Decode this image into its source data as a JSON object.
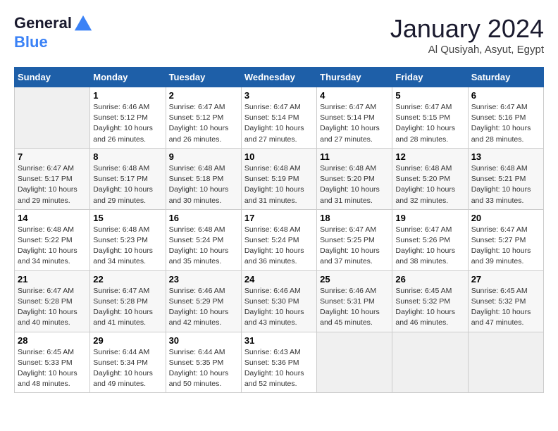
{
  "header": {
    "logo_line1": "General",
    "logo_line2": "Blue",
    "month": "January 2024",
    "location": "Al Qusiyah, Asyut, Egypt"
  },
  "weekdays": [
    "Sunday",
    "Monday",
    "Tuesday",
    "Wednesday",
    "Thursday",
    "Friday",
    "Saturday"
  ],
  "weeks": [
    [
      null,
      {
        "day": 1,
        "sunrise": "6:46 AM",
        "sunset": "5:12 PM",
        "daylight": "10 hours and 26 minutes."
      },
      {
        "day": 2,
        "sunrise": "6:47 AM",
        "sunset": "5:12 PM",
        "daylight": "10 hours and 26 minutes."
      },
      {
        "day": 3,
        "sunrise": "6:47 AM",
        "sunset": "5:14 PM",
        "daylight": "10 hours and 27 minutes."
      },
      {
        "day": 4,
        "sunrise": "6:47 AM",
        "sunset": "5:14 PM",
        "daylight": "10 hours and 27 minutes."
      },
      {
        "day": 5,
        "sunrise": "6:47 AM",
        "sunset": "5:15 PM",
        "daylight": "10 hours and 28 minutes."
      },
      {
        "day": 6,
        "sunrise": "6:47 AM",
        "sunset": "5:16 PM",
        "daylight": "10 hours and 28 minutes."
      }
    ],
    [
      {
        "day": 7,
        "sunrise": "6:47 AM",
        "sunset": "5:17 PM",
        "daylight": "10 hours and 29 minutes."
      },
      {
        "day": 8,
        "sunrise": "6:48 AM",
        "sunset": "5:17 PM",
        "daylight": "10 hours and 29 minutes."
      },
      {
        "day": 9,
        "sunrise": "6:48 AM",
        "sunset": "5:18 PM",
        "daylight": "10 hours and 30 minutes."
      },
      {
        "day": 10,
        "sunrise": "6:48 AM",
        "sunset": "5:19 PM",
        "daylight": "10 hours and 31 minutes."
      },
      {
        "day": 11,
        "sunrise": "6:48 AM",
        "sunset": "5:20 PM",
        "daylight": "10 hours and 31 minutes."
      },
      {
        "day": 12,
        "sunrise": "6:48 AM",
        "sunset": "5:20 PM",
        "daylight": "10 hours and 32 minutes."
      },
      {
        "day": 13,
        "sunrise": "6:48 AM",
        "sunset": "5:21 PM",
        "daylight": "10 hours and 33 minutes."
      }
    ],
    [
      {
        "day": 14,
        "sunrise": "6:48 AM",
        "sunset": "5:22 PM",
        "daylight": "10 hours and 34 minutes."
      },
      {
        "day": 15,
        "sunrise": "6:48 AM",
        "sunset": "5:23 PM",
        "daylight": "10 hours and 34 minutes."
      },
      {
        "day": 16,
        "sunrise": "6:48 AM",
        "sunset": "5:24 PM",
        "daylight": "10 hours and 35 minutes."
      },
      {
        "day": 17,
        "sunrise": "6:48 AM",
        "sunset": "5:24 PM",
        "daylight": "10 hours and 36 minutes."
      },
      {
        "day": 18,
        "sunrise": "6:47 AM",
        "sunset": "5:25 PM",
        "daylight": "10 hours and 37 minutes."
      },
      {
        "day": 19,
        "sunrise": "6:47 AM",
        "sunset": "5:26 PM",
        "daylight": "10 hours and 38 minutes."
      },
      {
        "day": 20,
        "sunrise": "6:47 AM",
        "sunset": "5:27 PM",
        "daylight": "10 hours and 39 minutes."
      }
    ],
    [
      {
        "day": 21,
        "sunrise": "6:47 AM",
        "sunset": "5:28 PM",
        "daylight": "10 hours and 40 minutes."
      },
      {
        "day": 22,
        "sunrise": "6:47 AM",
        "sunset": "5:28 PM",
        "daylight": "10 hours and 41 minutes."
      },
      {
        "day": 23,
        "sunrise": "6:46 AM",
        "sunset": "5:29 PM",
        "daylight": "10 hours and 42 minutes."
      },
      {
        "day": 24,
        "sunrise": "6:46 AM",
        "sunset": "5:30 PM",
        "daylight": "10 hours and 43 minutes."
      },
      {
        "day": 25,
        "sunrise": "6:46 AM",
        "sunset": "5:31 PM",
        "daylight": "10 hours and 45 minutes."
      },
      {
        "day": 26,
        "sunrise": "6:45 AM",
        "sunset": "5:32 PM",
        "daylight": "10 hours and 46 minutes."
      },
      {
        "day": 27,
        "sunrise": "6:45 AM",
        "sunset": "5:32 PM",
        "daylight": "10 hours and 47 minutes."
      }
    ],
    [
      {
        "day": 28,
        "sunrise": "6:45 AM",
        "sunset": "5:33 PM",
        "daylight": "10 hours and 48 minutes."
      },
      {
        "day": 29,
        "sunrise": "6:44 AM",
        "sunset": "5:34 PM",
        "daylight": "10 hours and 49 minutes."
      },
      {
        "day": 30,
        "sunrise": "6:44 AM",
        "sunset": "5:35 PM",
        "daylight": "10 hours and 50 minutes."
      },
      {
        "day": 31,
        "sunrise": "6:43 AM",
        "sunset": "5:36 PM",
        "daylight": "10 hours and 52 minutes."
      },
      null,
      null,
      null
    ]
  ],
  "labels": {
    "sunrise_prefix": "Sunrise: ",
    "sunset_prefix": "Sunset: ",
    "daylight_prefix": "Daylight: "
  }
}
